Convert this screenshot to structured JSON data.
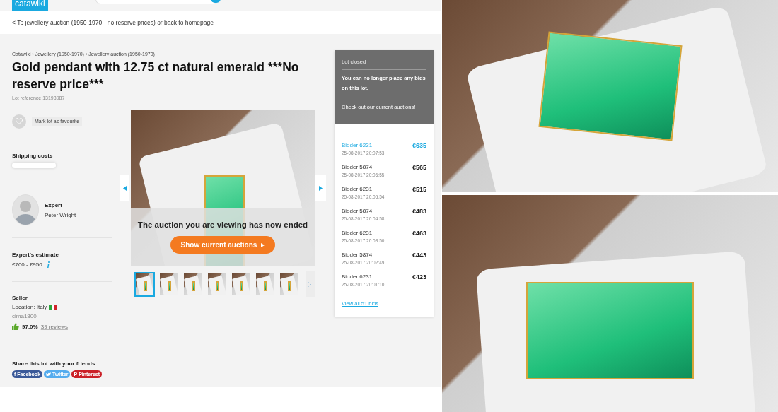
{
  "header": {
    "logo": "catawiki"
  },
  "back_link": "< To jewellery auction (1950-1970 - no reserve prices) or back to homepage",
  "breadcrumb": "Catawiki › Jewellery (1950-1970) › Jewellery auction (1950-1970)",
  "title": "Gold pendant with 12.75 ct natural emerald ***No reserve price***",
  "lot_reference": "Lot reference 13198987",
  "favourite": {
    "label": "Mark lot as favourite"
  },
  "shipping": {
    "heading": "Shipping costs"
  },
  "expert": {
    "label": "Expert",
    "name": "Peter Wright"
  },
  "estimate": {
    "heading": "Expert's estimate",
    "value": "€700 - €950"
  },
  "seller": {
    "heading": "Seller",
    "location": "Location: Italy",
    "username": "cima1800",
    "rating": "97.0%",
    "reviews": "39 reviews"
  },
  "share": {
    "heading": "Share this lot with your friends",
    "buttons": [
      {
        "kind": "facebook",
        "icon": "f",
        "label": "Facebook",
        "color": "#3b5998"
      },
      {
        "kind": "twitter",
        "label": "Twitter",
        "color": "#55acee"
      },
      {
        "kind": "pinterest",
        "icon": "P",
        "label": "Pinterest",
        "color": "#cb2027"
      }
    ]
  },
  "gallery": {
    "overlay_text": "The auction you are viewing has now ended",
    "button": "Show current auctions",
    "thumbnails": [
      {
        "selected": true
      },
      {
        "selected": false
      },
      {
        "selected": false
      },
      {
        "selected": false
      },
      {
        "selected": false
      },
      {
        "selected": false
      },
      {
        "selected": false
      }
    ]
  },
  "lot_status": {
    "title": "Lot closed",
    "message": "You can no longer place any bids on this lot.",
    "link": "Check out our current auctions!"
  },
  "bids": {
    "items": [
      {
        "bidder": "Bidder 6231",
        "time": "25-08-2017 20:07:53",
        "amount": "€635",
        "leading": true
      },
      {
        "bidder": "Bidder 5874",
        "time": "25-08-2017 20:06:55",
        "amount": "€565",
        "leading": false
      },
      {
        "bidder": "Bidder 6231",
        "time": "25-08-2017 20:05:54",
        "amount": "€515",
        "leading": false
      },
      {
        "bidder": "Bidder 5874",
        "time": "25-08-2017 20:04:58",
        "amount": "€483",
        "leading": false
      },
      {
        "bidder": "Bidder 6231",
        "time": "25-08-2017 20:03:50",
        "amount": "€463",
        "leading": false
      },
      {
        "bidder": "Bidder 5874",
        "time": "25-08-2017 20:02:49",
        "amount": "€443",
        "leading": false
      },
      {
        "bidder": "Bidder 6231",
        "time": "25-08-2017 20:01:10",
        "amount": "€423",
        "leading": false
      }
    ],
    "view_all": "View all 51 bids"
  }
}
